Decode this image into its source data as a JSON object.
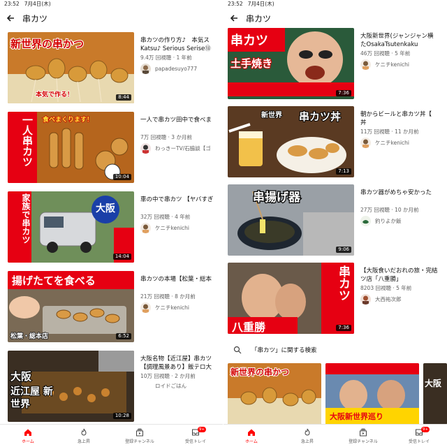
{
  "colors": {
    "accent": "#ff0000",
    "text": "#0f0f0f",
    "meta": "#606060"
  },
  "left": {
    "status_bar": "23:52   7月4日(木)",
    "title": "串カツ",
    "videos": [
      {
        "title_line1": "串カツの作り方♪　本気ス",
        "title_line2": "Katsu♪ Serious Serise⑬",
        "meta": "9.4万 回視聴 · 1 年前",
        "channel": "papadesuyo777",
        "duration": "8:44",
        "thumb_caption": "新世界の串かつ",
        "thumb_sub": "本気で作る！"
      },
      {
        "title_line1": "一人で串カツ田中で食べま",
        "title_line2": "",
        "meta": "7万 回視聴 · 3 か月前",
        "channel": "わっきーTV/石脇談【ゴ",
        "duration": "10:04",
        "thumb_caption": "一人串カツ",
        "thumb_sub": "食べまくります！"
      },
      {
        "title_line1": "車の中で串カツ 【ヤバすぎ",
        "title_line2": "",
        "meta": "32万 回視聴 · 4 年前",
        "channel": "ケニチkenichi",
        "duration": "14:04",
        "thumb_caption": "家族で串カツ",
        "thumb_sub": "大阪"
      },
      {
        "title_line1": "串カツの本場【松葉・総本",
        "title_line2": "",
        "meta": "21万 回視聴 · 8 か月前",
        "channel": "ケニチkenichi",
        "duration": "6:52",
        "thumb_caption": "揚げたてを食べる",
        "thumb_sub": "松葉・総本店"
      },
      {
        "title_line1": "大阪名物【近江屋】串カツ",
        "title_line2": "【調理風景あり】飯テロ大",
        "meta": "10万 回視聴 · 2 か月前",
        "channel": "ロイドごはん",
        "duration": "10:28",
        "thumb_caption": "大阪",
        "thumb_sub": "近江屋 新世界"
      }
    ],
    "nav": [
      {
        "label": "ホーム",
        "icon": "home-icon"
      },
      {
        "label": "急上昇",
        "icon": "explore-icon"
      },
      {
        "label": "登録チャンネル",
        "icon": "subscriptions-icon"
      },
      {
        "label": "受信トレイ",
        "icon": "inbox-icon",
        "badge": "9+"
      }
    ]
  },
  "right": {
    "status_bar": "23:52   7月4日(木)",
    "title": "串カツ",
    "videos": [
      {
        "title_line1": "大阪新世界(ジャンジャン横",
        "title_line2": "たOsakaTsutenkaku",
        "meta": "46万 回視聴 · 5 年前",
        "channel": "ケニチkenichi",
        "duration": "7:36",
        "thumb_caption": "串カツ",
        "thumb_sub": "土手焼き"
      },
      {
        "title_line1": "朝からビールと串カツ丼【",
        "title_line2": "丼",
        "meta": "11万 回視聴 · 11 か月前",
        "channel": "ケニチkenichi",
        "duration": "7:13",
        "thumb_caption": "串カツ丼",
        "thumb_sub": "新世界"
      },
      {
        "title_line1": "串カツ器がめちゃ安かった",
        "title_line2": "",
        "meta": "27万 回視聴 · 10 か月前",
        "channel": "釣りよか飯",
        "duration": "9:06",
        "thumb_caption": "串揚げ器",
        "thumb_sub": ""
      },
      {
        "title_line1": "【大阪食いだおれの旅・完結",
        "title_line2": "ツ店「八重勝」",
        "meta": "8203 回視聴 · 5 年前",
        "channel": "大西祐次郎",
        "duration": "7:36",
        "thumb_caption": "串カツ",
        "thumb_sub": "八重勝"
      }
    ],
    "related_label": "「串カツ」に関する検索",
    "related": [
      {
        "caption": "新世界の串かつ"
      },
      {
        "caption": "大阪新世界巡り"
      },
      {
        "caption": "大阪"
      }
    ],
    "nav": [
      {
        "label": "ホーム",
        "icon": "home-icon"
      },
      {
        "label": "急上昇",
        "icon": "explore-icon"
      },
      {
        "label": "登録チャンネル",
        "icon": "subscriptions-icon"
      },
      {
        "label": "受信トレイ",
        "icon": "inbox-icon",
        "badge": "9+"
      }
    ]
  }
}
